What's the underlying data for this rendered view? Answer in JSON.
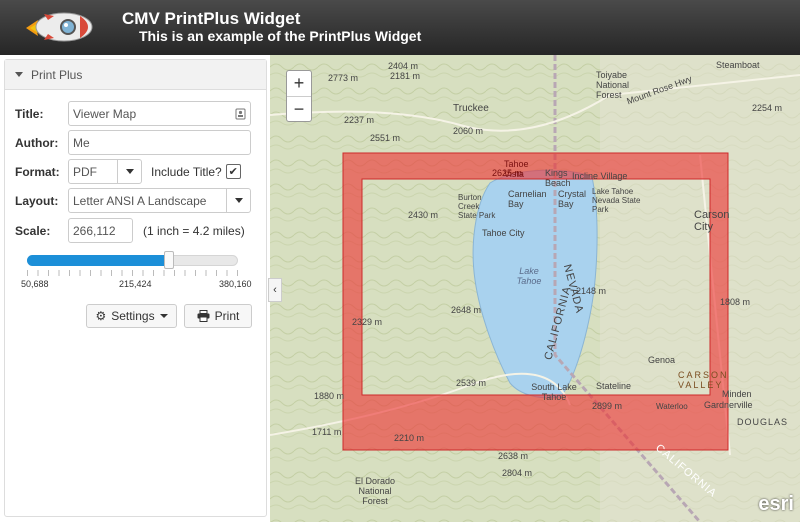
{
  "header": {
    "title": "CMV PrintPlus Widget",
    "subtitle": "This is an example of the PrintPlus Widget"
  },
  "panel": {
    "heading": "Print Plus",
    "title_label": "Title:",
    "title_value": "Viewer Map",
    "author_label": "Author:",
    "author_value": "Me",
    "format_label": "Format:",
    "format_value": "PDF",
    "include_title_label": "Include Title?",
    "include_title_checked": "✔",
    "layout_label": "Layout:",
    "layout_value": "Letter ANSI A Landscape",
    "scale_label": "Scale:",
    "scale_value": "266,112",
    "scale_note": "(1 inch = 4.2 miles)",
    "slider": {
      "min_label": "50,688",
      "mid_label": "215,424",
      "max_label": "380,160",
      "fraction": 0.65
    },
    "settings_button": "Settings",
    "print_button": "Print"
  },
  "map": {
    "zoom_in": "+",
    "zoom_out": "−",
    "collapse_glyph": "‹",
    "attribution": "esri",
    "print_area_color": "#ee3333",
    "labels": [
      {
        "text": "2773 m",
        "italic": false
      },
      {
        "text": "2404 m",
        "italic": false
      },
      {
        "text": "2181 m",
        "italic": false
      },
      {
        "text": "Truckee",
        "italic": false
      },
      {
        "text": "Toiyabe National Forest",
        "italic": false
      },
      {
        "text": "Steamboat",
        "italic": false
      },
      {
        "text": "Mount Rose Hwy",
        "italic": false
      },
      {
        "text": "2237 m",
        "italic": false
      },
      {
        "text": "2060 m",
        "italic": false
      },
      {
        "text": "2551 m",
        "italic": false
      },
      {
        "text": "2254 m",
        "italic": false
      },
      {
        "text": "Tahoe Vista",
        "italic": false
      },
      {
        "text": "Kings Beach",
        "italic": false
      },
      {
        "text": "Incline Village",
        "italic": false
      },
      {
        "text": "Crystal Bay",
        "italic": false
      },
      {
        "text": "Carnelian Bay",
        "italic": false
      },
      {
        "text": "Lake Tahoe Nevada State Park",
        "italic": false
      },
      {
        "text": "Burton Creek State Park",
        "italic": false
      },
      {
        "text": "Carson City",
        "italic": false
      },
      {
        "text": "2430 m",
        "italic": false
      },
      {
        "text": "Tahoe City",
        "italic": false
      },
      {
        "text": "Lake Tahoe",
        "italic": true
      },
      {
        "text": "2148 m",
        "italic": false
      },
      {
        "text": "2648 m",
        "italic": false
      },
      {
        "text": "1808 m",
        "italic": false
      },
      {
        "text": "2329 m",
        "italic": false
      },
      {
        "text": "CALIFORNIA",
        "italic": false
      },
      {
        "text": "NEVADA",
        "italic": false
      },
      {
        "text": "2539 m",
        "italic": false
      },
      {
        "text": "South Lake Tahoe",
        "italic": false
      },
      {
        "text": "Stateline",
        "italic": false
      },
      {
        "text": "Minden",
        "italic": false
      },
      {
        "text": "Gardnerville",
        "italic": false
      },
      {
        "text": "CARSON VALLEY",
        "italic": false
      },
      {
        "text": "DOUGLAS",
        "italic": false
      },
      {
        "text": "1880 m",
        "italic": false
      },
      {
        "text": "1711 m",
        "italic": false
      },
      {
        "text": "2210 m",
        "italic": false
      },
      {
        "text": "2899 m",
        "italic": false
      },
      {
        "text": "2638 m",
        "italic": false
      },
      {
        "text": "2804 m",
        "italic": false
      },
      {
        "text": "El Dorado National Forest",
        "italic": false
      },
      {
        "text": "CALIFORNIA",
        "italic": false
      },
      {
        "text": "2625 m",
        "italic": false
      },
      {
        "text": "Genoa",
        "italic": false
      },
      {
        "text": "Waterloo",
        "italic": false
      }
    ]
  }
}
